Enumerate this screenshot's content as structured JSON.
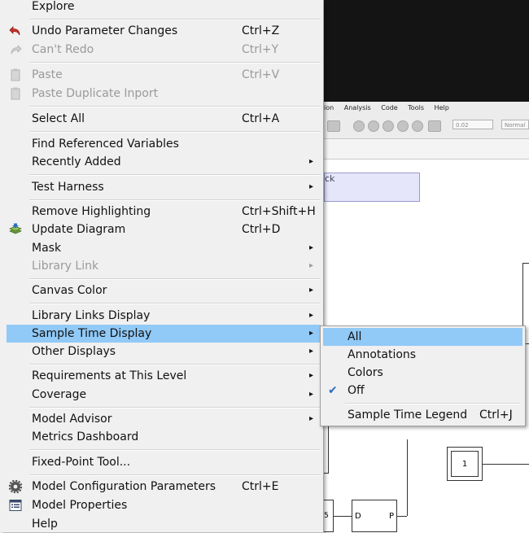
{
  "background": {
    "menubar": [
      "ion",
      "Analysis",
      "Code",
      "Tools",
      "Help"
    ],
    "sim_time": "0.02",
    "sim_mode": "Normal",
    "note_text": "ck",
    "constant_value": "1",
    "pid_in": "D",
    "pid_out": "P",
    "small_block": "5"
  },
  "menu": {
    "items": [
      {
        "label": "Explore"
      },
      {
        "label": "Undo Parameter Changes",
        "shortcut": "Ctrl+Z",
        "icon": "undo-icon"
      },
      {
        "label": "Can't Redo",
        "shortcut": "Ctrl+Y",
        "icon": "redo-icon",
        "disabled": true
      },
      {
        "label": "Paste",
        "shortcut": "Ctrl+V",
        "icon": "paste-icon",
        "disabled": true
      },
      {
        "label": "Paste Duplicate Inport",
        "icon": "paste-duplicate-icon",
        "disabled": true
      },
      {
        "label": "Select All",
        "shortcut": "Ctrl+A"
      },
      {
        "label": "Find Referenced Variables"
      },
      {
        "label": "Recently Added"
      },
      {
        "label": "Test Harness"
      },
      {
        "label": "Remove Highlighting",
        "shortcut": "Ctrl+Shift+H"
      },
      {
        "label": "Update Diagram",
        "shortcut": "Ctrl+D",
        "icon": "update-diagram-icon"
      },
      {
        "label": "Mask"
      },
      {
        "label": "Library Link",
        "disabled": true
      },
      {
        "label": "Canvas Color"
      },
      {
        "label": "Library Links Display"
      },
      {
        "label": "Sample Time Display",
        "highlighted": true
      },
      {
        "label": "Other Displays"
      },
      {
        "label": "Requirements at This Level"
      },
      {
        "label": "Coverage"
      },
      {
        "label": "Model Advisor"
      },
      {
        "label": "Metrics Dashboard"
      },
      {
        "label": "Fixed-Point Tool..."
      },
      {
        "label": "Model Configuration Parameters",
        "shortcut": "Ctrl+E",
        "icon": "gear-icon"
      },
      {
        "label": "Model Properties",
        "icon": "properties-icon"
      },
      {
        "label": "Help"
      }
    ]
  },
  "submenu": {
    "items": [
      {
        "label": "All",
        "highlighted": true
      },
      {
        "label": "Annotations"
      },
      {
        "label": "Colors"
      },
      {
        "label": "Off",
        "checked": true
      },
      {
        "label": "Sample Time Legend",
        "shortcut": "Ctrl+J"
      }
    ]
  },
  "colors": {
    "highlight": "#91c9f7",
    "menu_bg": "#f0f0f0",
    "disabled_text": "#9a9a9a",
    "check": "#2b6cc4"
  }
}
